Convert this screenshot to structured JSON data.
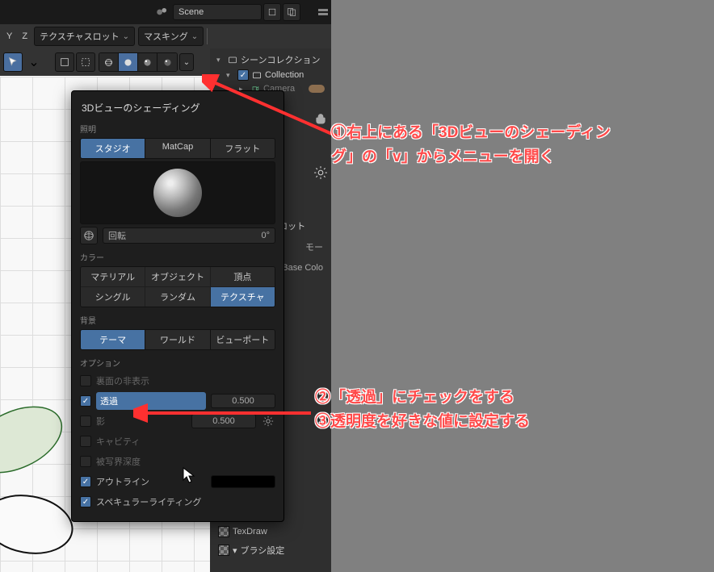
{
  "topbar": {
    "scene": "Scene"
  },
  "header2": {
    "axis_y": "Y",
    "axis_z": "Z",
    "texslot": "テクスチャスロット",
    "masking": "マスキング"
  },
  "outliner": {
    "root": "シーンコレクション",
    "collection": "Collection",
    "camera": "Camera"
  },
  "props": {
    "texslot_label": "テクスチャスロット",
    "mode_label": "モー",
    "basecolor": "Base Colo",
    "texdraw": "TexDraw",
    "brush_settings": "ブラシ設定"
  },
  "panel": {
    "title": "3Dビューのシェーディング",
    "lighting_label": "照明",
    "lighting_tabs": {
      "studio": "スタジオ",
      "matcap": "MatCap",
      "flat": "フラット"
    },
    "rotation_label": "回転",
    "rotation_value": "0°",
    "color_label": "カラー",
    "color_grid": {
      "material": "マテリアル",
      "object": "オブジェクト",
      "vertex": "頂点",
      "single": "シングル",
      "random": "ランダム",
      "texture": "テクスチャ"
    },
    "bg_label": "背景",
    "bg_tabs": {
      "theme": "テーマ",
      "world": "ワールド",
      "viewport": "ビューポート"
    },
    "options_label": "オプション",
    "opt_backface": "裏面の非表示",
    "opt_xray": "透過",
    "opt_xray_val": "0.500",
    "opt_shadow": "影",
    "opt_shadow_val": "0.500",
    "opt_cavity": "キャビティ",
    "opt_dof": "被写界深度",
    "opt_outline": "アウトライン",
    "opt_specular": "スペキュラーライティング"
  },
  "anno": {
    "a1_l1": "①右上にある「3Dビューのシェーディン",
    "a1_l2": "グ」の「v」からメニューを開く",
    "a2_l1": "②「透過」にチェックをする",
    "a2_l2": "③透明度を好きな値に設定する"
  }
}
